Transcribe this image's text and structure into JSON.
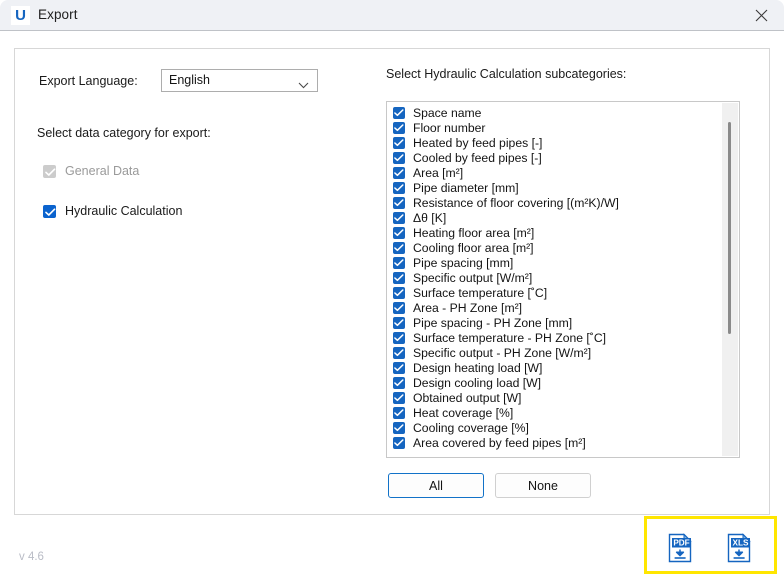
{
  "window": {
    "title": "Export",
    "logo_letter": "U",
    "close_icon": "close-icon"
  },
  "form": {
    "language_label": "Export Language:",
    "language_value": "English",
    "language_options": [
      "English"
    ],
    "category_label": "Select data category for export:",
    "categories": [
      {
        "label": "General Data",
        "checked": true,
        "disabled": true
      },
      {
        "label": "Hydraulic Calculation",
        "checked": true,
        "disabled": false
      }
    ]
  },
  "subcategories": {
    "label": "Select Hydraulic Calculation subcategories:",
    "items": [
      {
        "label": "Space name",
        "checked": true
      },
      {
        "label": "Floor number",
        "checked": true
      },
      {
        "label": "Heated by feed pipes [-]",
        "checked": true
      },
      {
        "label": "Cooled by feed pipes [-]",
        "checked": true
      },
      {
        "label": "Area [m²]",
        "checked": true
      },
      {
        "label": "Pipe diameter [mm]",
        "checked": true
      },
      {
        "label": "Resistance of floor covering [(m²K)/W]",
        "checked": true
      },
      {
        "label": "Δθ [K]",
        "checked": true
      },
      {
        "label": "Heating floor area [m²]",
        "checked": true
      },
      {
        "label": "Cooling floor area [m²]",
        "checked": true
      },
      {
        "label": "Pipe spacing [mm]",
        "checked": true
      },
      {
        "label": "Specific output [W/m²]",
        "checked": true
      },
      {
        "label": "Surface temperature [˚C]",
        "checked": true
      },
      {
        "label": "Area - PH Zone [m²]",
        "checked": true
      },
      {
        "label": "Pipe spacing - PH Zone [mm]",
        "checked": true
      },
      {
        "label": "Surface temperature - PH Zone [˚C]",
        "checked": true
      },
      {
        "label": "Specific output - PH Zone [W/m²]",
        "checked": true
      },
      {
        "label": "Design heating load [W]",
        "checked": true
      },
      {
        "label": "Design cooling load [W]",
        "checked": true
      },
      {
        "label": "Obtained output [W]",
        "checked": true
      },
      {
        "label": "Heat coverage [%]",
        "checked": true
      },
      {
        "label": "Cooling coverage [%]",
        "checked": true
      },
      {
        "label": "Area covered by feed pipes [m²]",
        "checked": true
      }
    ]
  },
  "selection_buttons": {
    "all_label": "All",
    "none_label": "None"
  },
  "export_buttons": {
    "pdf_label": "PDF",
    "xls_label": "XLS",
    "pdf_icon": "pdf-download-icon",
    "xls_icon": "xls-download-icon",
    "highlight_color": "#ffe600"
  },
  "footer": {
    "version": "v 4.6"
  },
  "colors": {
    "accent": "#1565c0",
    "checkbox_blue": "#0b63ce",
    "titlebar_bg": "#eff1f5",
    "focus_border": "#1272c8"
  }
}
